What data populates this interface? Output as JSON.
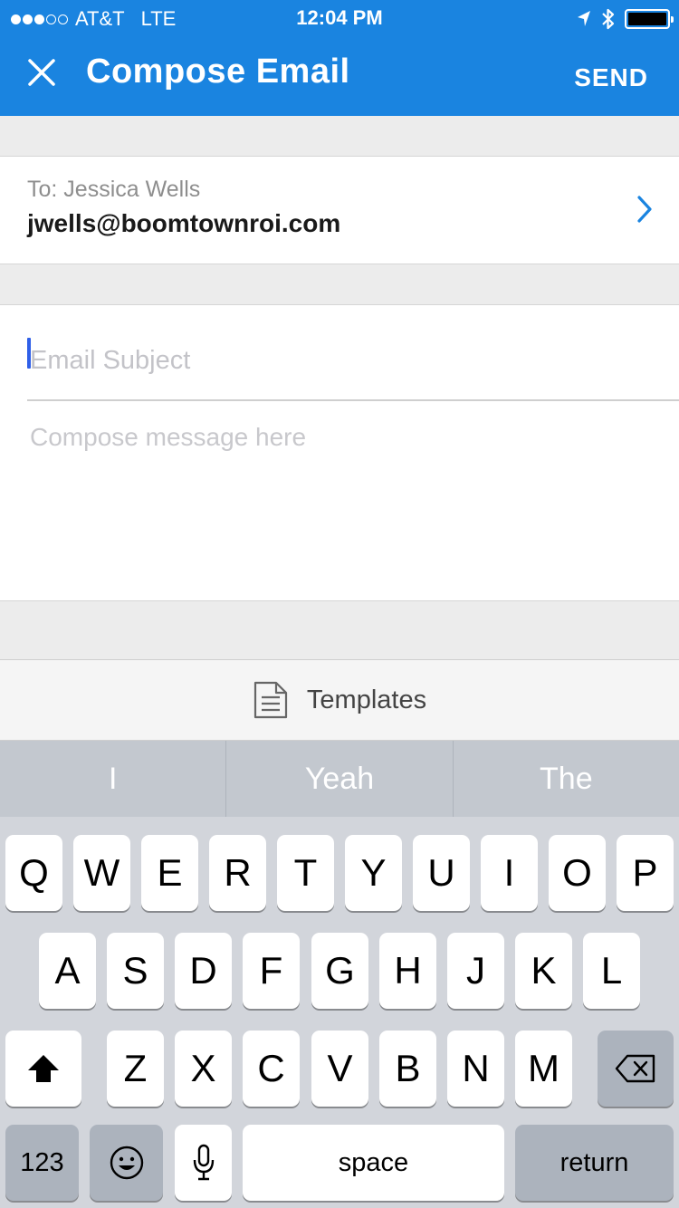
{
  "status_bar": {
    "carrier": "AT&T",
    "network": "LTE",
    "time": "12:04 PM",
    "signal_bars_filled": 3,
    "signal_bars_total": 5
  },
  "nav": {
    "title": "Compose Email",
    "send_label": "SEND",
    "close_icon": "close-icon"
  },
  "recipient": {
    "to_label": "To: Jessica Wells",
    "email": "jwells@boomtownroi.com"
  },
  "compose": {
    "subject_placeholder": "Email Subject",
    "message_placeholder": "Compose message here"
  },
  "templates": {
    "label": "Templates",
    "icon": "document-icon"
  },
  "keyboard": {
    "predictions": [
      "I",
      "Yeah",
      "The"
    ],
    "row1": [
      "Q",
      "W",
      "E",
      "R",
      "T",
      "Y",
      "U",
      "I",
      "O",
      "P"
    ],
    "row2": [
      "A",
      "S",
      "D",
      "F",
      "G",
      "H",
      "J",
      "K",
      "L"
    ],
    "row3": [
      "Z",
      "X",
      "C",
      "V",
      "B",
      "N",
      "M"
    ],
    "numbers_label": "123",
    "space_label": "space",
    "return_label": "return"
  },
  "colors": {
    "header": "#1a84e0",
    "chevron": "#1a84e0",
    "cursor": "#2f5fe8",
    "keyboard_bg": "#d2d5db"
  }
}
